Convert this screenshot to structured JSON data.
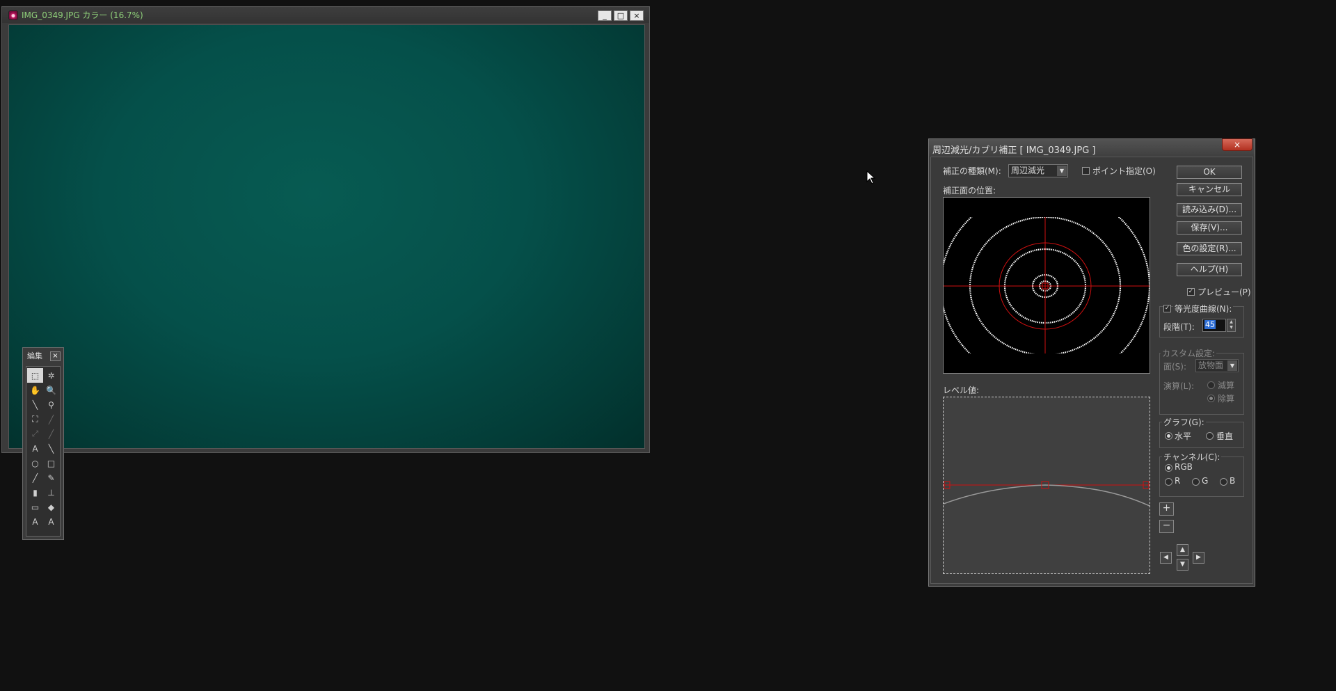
{
  "image_window": {
    "title": "IMG_0349.JPG カラー (16.7%)",
    "minimize": "_",
    "maximize": "□",
    "close": "×"
  },
  "toolbox": {
    "title": "編集",
    "close": "×",
    "tools": [
      {
        "name": "rect-select-tool-icon",
        "glyph": "⬚",
        "state": "selected"
      },
      {
        "name": "magic-wand-tool-icon",
        "glyph": "✲",
        "state": "normal"
      },
      {
        "name": "hand-tool-icon",
        "glyph": "✋",
        "state": "dim"
      },
      {
        "name": "zoom-tool-icon",
        "glyph": "🔍",
        "state": "normal"
      },
      {
        "name": "eyedropper-tool-icon",
        "glyph": "╲",
        "state": "normal"
      },
      {
        "name": "color-picker-tool-icon",
        "glyph": "⚲",
        "state": "normal"
      },
      {
        "name": "crop-tool-icon",
        "glyph": "⛶",
        "state": "normal"
      },
      {
        "name": "measure-tool-icon",
        "glyph": "╱",
        "state": "dim"
      },
      {
        "name": "transform-tool-icon",
        "glyph": "⤢",
        "state": "dim"
      },
      {
        "name": "pen-tool-icon",
        "glyph": "╱",
        "state": "dim"
      },
      {
        "name": "text-tool-icon",
        "glyph": "A",
        "state": "normal"
      },
      {
        "name": "line-tool-icon",
        "glyph": "╲",
        "state": "normal"
      },
      {
        "name": "ellipse-tool-icon",
        "glyph": "○",
        "state": "normal"
      },
      {
        "name": "rectangle-tool-icon",
        "glyph": "□",
        "state": "normal"
      },
      {
        "name": "brush-tool-icon",
        "glyph": "╱",
        "state": "normal"
      },
      {
        "name": "airbrush-tool-icon",
        "glyph": "✎",
        "state": "normal"
      },
      {
        "name": "eraser-tool-icon",
        "glyph": "▮",
        "state": "normal"
      },
      {
        "name": "stamp-tool-icon",
        "glyph": "⊥",
        "state": "normal"
      },
      {
        "name": "gradient-tool-icon",
        "glyph": "▭",
        "state": "normal"
      },
      {
        "name": "fill-tool-icon",
        "glyph": "◆",
        "state": "normal"
      },
      {
        "name": "text-a-tool-icon",
        "glyph": "A",
        "state": "normal"
      },
      {
        "name": "text-a2-tool-icon",
        "glyph": "A",
        "state": "normal"
      }
    ]
  },
  "dialog": {
    "title": "周辺減光/カブリ補正 [ IMG_0349.JPG ]",
    "close": "×",
    "correction_type_label": "補正の種類(M):",
    "correction_type_value": "周辺減光",
    "point_spec_label": "ポイント指定(O)",
    "plane_position_label": "補正面の位置:",
    "level_label": "レベル値:",
    "buttons": {
      "ok": "OK",
      "cancel": "キャンセル",
      "load": "読み込み(D)...",
      "save": "保存(V)...",
      "color_settings": "色の設定(R)...",
      "help": "ヘルプ(H)"
    },
    "preview_label": "プレビュー(P)",
    "isophote_label": "等光度曲線(N):",
    "steps_label": "段階(T):",
    "steps_value": "45",
    "custom": {
      "label": "カスタム設定:",
      "surface_label": "面(S):",
      "surface_value": "放物面",
      "operation_label": "演算(L):",
      "subtract": "減算",
      "divide": "除算"
    },
    "graph": {
      "label": "グラフ(G):",
      "horizontal": "水平",
      "vertical": "垂直"
    },
    "channel": {
      "label": "チャンネル(C):",
      "rgb": "RGB",
      "r": "R",
      "g": "G",
      "b": "B"
    },
    "plus": "+",
    "minus": "−",
    "arrows": {
      "up": "▲",
      "down": "▼",
      "left": "◀",
      "right": "▶"
    }
  },
  "colors": {
    "desktop": "#111111",
    "canvas": "#05504a",
    "title_green": "#8fd07a",
    "red_guide": "#d01010",
    "selection": "#2f6fd6"
  }
}
